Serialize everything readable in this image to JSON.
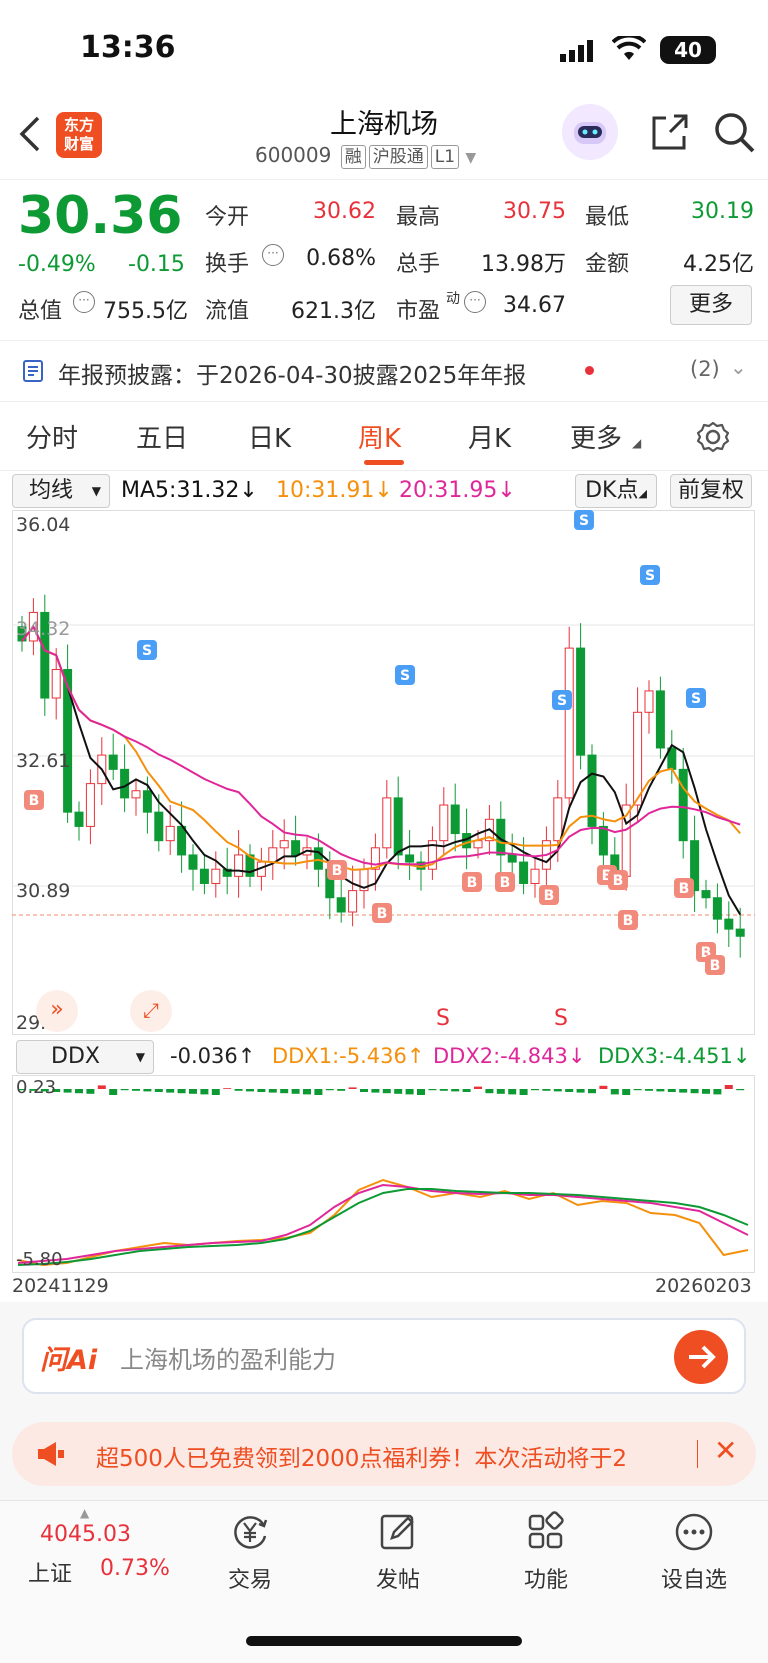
{
  "status_bar": {
    "time": "13:36",
    "battery": "40"
  },
  "header": {
    "title": "上海机场",
    "code": "600009",
    "tags": [
      "融",
      "沪股通",
      "L1"
    ],
    "logo_text": "东方财富"
  },
  "quote": {
    "price": "30.36",
    "change_pct": "-0.49%",
    "change": "-0.15",
    "open_label": "今开",
    "open": "30.62",
    "high_label": "最高",
    "high": "30.75",
    "low_label": "最低",
    "low": "30.19",
    "turnover_label": "换手",
    "turnover": "0.68%",
    "volume_label": "总手",
    "volume": "13.98万",
    "amount_label": "金额",
    "amount": "4.25亿",
    "mktcap_label": "总值",
    "mktcap": "755.5亿",
    "float_label": "流值",
    "float": "621.3亿",
    "pe_label": "市盈",
    "pe_sup": "动",
    "pe": "34.67",
    "more_label": "更多"
  },
  "notice": {
    "text": "年报预披露：于2026-04-30披露2025年年报",
    "count": "(2)"
  },
  "tabs": [
    "分时",
    "五日",
    "日K",
    "周K",
    "月K",
    "更多"
  ],
  "active_tab": "周K",
  "ma_bar": {
    "selector": "均线",
    "ma5": "MA5:31.32↓",
    "ma10": "10:31.91↓",
    "ma20": "20:31.95↓",
    "dk": "DK点",
    "adjust": "前复权"
  },
  "kchart": {
    "y_ticks": [
      "36.04",
      "34.32",
      "32.61",
      "30.89",
      "29.17"
    ],
    "bottom_markers": [
      "S",
      "S"
    ]
  },
  "ddx_bar": {
    "selector": "DDX",
    "ddx": "-0.036↑",
    "ddx1": "DDX1:-5.436↑",
    "ddx2": "DDX2:-4.843↓",
    "ddx3": "DDX3:-4.451↓"
  },
  "ddxchart": {
    "y_top": "0.23",
    "y_bottom": "-5.80"
  },
  "date_range": {
    "start": "20241129",
    "end": "20260203"
  },
  "ask": {
    "brand": "问Ai",
    "placeholder": "上海机场的盈利能力"
  },
  "promo": {
    "text": "超500人已免费领到2000点福利券！本次活动将于2"
  },
  "bottom_nav": {
    "index_value": "4045.03",
    "index_name": "上证",
    "index_change": "0.73%",
    "items": [
      "交易",
      "发帖",
      "功能",
      "设自选"
    ]
  },
  "colors": {
    "up": "#e8313a",
    "down": "#0d9a34",
    "ma5": "#111111",
    "ma10": "#f5900c",
    "ma20": "#e0279a",
    "accent": "#ef4d22"
  }
}
